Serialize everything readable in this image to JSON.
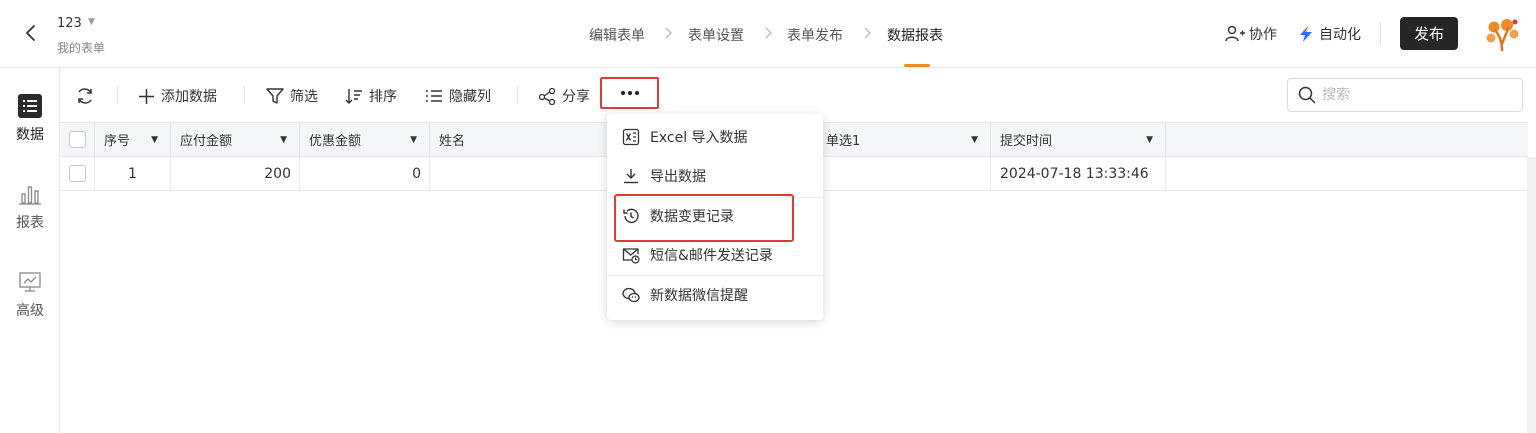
{
  "header": {
    "app_name": "123",
    "app_subtitle": "我的表单",
    "steps": [
      "编辑表单",
      "表单设置",
      "表单发布",
      "数据报表"
    ],
    "active_step": "数据报表",
    "collaborate_label": "协作",
    "automation_label": "自动化",
    "publish_label": "发布"
  },
  "sidebar": {
    "items": [
      {
        "label": "数据",
        "icon": "list-icon"
      },
      {
        "label": "报表",
        "icon": "bar-chart-icon"
      },
      {
        "label": "高级",
        "icon": "monitor-chart-icon"
      }
    ]
  },
  "toolbar": {
    "add_label": "添加数据",
    "filter_label": "筛选",
    "sort_label": "排序",
    "hide_columns_label": "隐藏列",
    "share_label": "分享",
    "more_label": "···",
    "search_placeholder": "搜索"
  },
  "table": {
    "columns": [
      "序号",
      "应付金额",
      "优惠金额",
      "姓名",
      "单选1",
      "提交时间"
    ],
    "rows": [
      {
        "index": "1",
        "amount_payable": "200",
        "discount": "0",
        "name": "",
        "choice": "",
        "submit_time": "2024-07-18 13:33:46"
      }
    ]
  },
  "more_menu": {
    "items": [
      {
        "label": "Excel 导入数据",
        "icon": "excel-import-icon"
      },
      {
        "label": "导出数据",
        "icon": "download-icon"
      },
      {
        "label": "数据变更记录",
        "icon": "history-icon"
      },
      {
        "label": "短信&邮件发送记录",
        "icon": "mail-clock-icon"
      },
      {
        "label": "新数据微信提醒",
        "icon": "wechat-icon"
      }
    ]
  },
  "colors": {
    "accent": "#f08a25",
    "highlight_border": "#e53935",
    "publish_bg": "#262626"
  }
}
